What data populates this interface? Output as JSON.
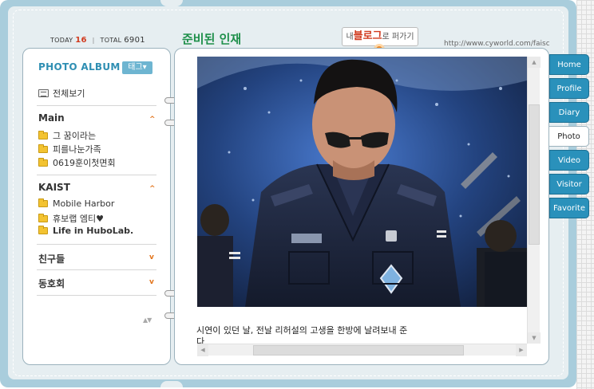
{
  "header": {
    "today_label": "TODAY",
    "today_count": "16",
    "total_label": "TOTAL",
    "total_count": "6901",
    "home_title": "준비된 인재",
    "blog_badge_pre": "내",
    "blog_badge_big": "블로그",
    "blog_badge_post": "로 퍼가기",
    "url": "http://www.cyworld.com/faisca"
  },
  "sidebar": {
    "album_title": "PHOTO ALBUM",
    "tag_button": "태그▾",
    "view_all": "전체보기",
    "groups": [
      {
        "title": "Main",
        "expanded": true,
        "items": [
          {
            "label": "그 꿈이라는",
            "bold": false
          },
          {
            "label": "피를나눈가족",
            "bold": false
          },
          {
            "label": "0619훈이첫면회",
            "bold": false
          }
        ]
      },
      {
        "title": "KAIST",
        "expanded": true,
        "items": [
          {
            "label": "Mobile Harbor",
            "bold": false
          },
          {
            "label": "휴보랩 엠티♥",
            "bold": false
          },
          {
            "label": "Life in HuboLab.",
            "bold": true
          }
        ]
      },
      {
        "title": "친구들",
        "expanded": false,
        "items": []
      },
      {
        "title": "동호회",
        "expanded": false,
        "items": []
      }
    ]
  },
  "content": {
    "caption_line1": "시연이 있던 날, 전날 리허설의 고생을 한방에 날려보내 준",
    "caption_line2": "다"
  },
  "tabs": [
    {
      "label": "Home",
      "active": false
    },
    {
      "label": "Profile",
      "active": false
    },
    {
      "label": "Diary",
      "active": false
    },
    {
      "label": "Photo",
      "active": true
    },
    {
      "label": "Video",
      "active": false
    },
    {
      "label": "Visitor",
      "active": false
    },
    {
      "label": "Favorite",
      "active": false
    }
  ],
  "colors": {
    "frame": "#a9cddc",
    "tab": "#2a91bb",
    "title_green": "#1e8f4a",
    "accent_orange": "#e2741b"
  }
}
